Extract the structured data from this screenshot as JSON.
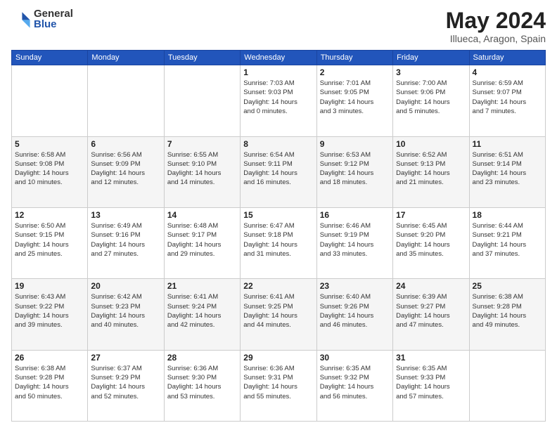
{
  "header": {
    "logo_general": "General",
    "logo_blue": "Blue",
    "month": "May 2024",
    "location": "Illueca, Aragon, Spain"
  },
  "weekdays": [
    "Sunday",
    "Monday",
    "Tuesday",
    "Wednesday",
    "Thursday",
    "Friday",
    "Saturday"
  ],
  "weeks": [
    [
      {
        "day": "",
        "info": ""
      },
      {
        "day": "",
        "info": ""
      },
      {
        "day": "",
        "info": ""
      },
      {
        "day": "1",
        "info": "Sunrise: 7:03 AM\nSunset: 9:03 PM\nDaylight: 14 hours\nand 0 minutes."
      },
      {
        "day": "2",
        "info": "Sunrise: 7:01 AM\nSunset: 9:05 PM\nDaylight: 14 hours\nand 3 minutes."
      },
      {
        "day": "3",
        "info": "Sunrise: 7:00 AM\nSunset: 9:06 PM\nDaylight: 14 hours\nand 5 minutes."
      },
      {
        "day": "4",
        "info": "Sunrise: 6:59 AM\nSunset: 9:07 PM\nDaylight: 14 hours\nand 7 minutes."
      }
    ],
    [
      {
        "day": "5",
        "info": "Sunrise: 6:58 AM\nSunset: 9:08 PM\nDaylight: 14 hours\nand 10 minutes."
      },
      {
        "day": "6",
        "info": "Sunrise: 6:56 AM\nSunset: 9:09 PM\nDaylight: 14 hours\nand 12 minutes."
      },
      {
        "day": "7",
        "info": "Sunrise: 6:55 AM\nSunset: 9:10 PM\nDaylight: 14 hours\nand 14 minutes."
      },
      {
        "day": "8",
        "info": "Sunrise: 6:54 AM\nSunset: 9:11 PM\nDaylight: 14 hours\nand 16 minutes."
      },
      {
        "day": "9",
        "info": "Sunrise: 6:53 AM\nSunset: 9:12 PM\nDaylight: 14 hours\nand 18 minutes."
      },
      {
        "day": "10",
        "info": "Sunrise: 6:52 AM\nSunset: 9:13 PM\nDaylight: 14 hours\nand 21 minutes."
      },
      {
        "day": "11",
        "info": "Sunrise: 6:51 AM\nSunset: 9:14 PM\nDaylight: 14 hours\nand 23 minutes."
      }
    ],
    [
      {
        "day": "12",
        "info": "Sunrise: 6:50 AM\nSunset: 9:15 PM\nDaylight: 14 hours\nand 25 minutes."
      },
      {
        "day": "13",
        "info": "Sunrise: 6:49 AM\nSunset: 9:16 PM\nDaylight: 14 hours\nand 27 minutes."
      },
      {
        "day": "14",
        "info": "Sunrise: 6:48 AM\nSunset: 9:17 PM\nDaylight: 14 hours\nand 29 minutes."
      },
      {
        "day": "15",
        "info": "Sunrise: 6:47 AM\nSunset: 9:18 PM\nDaylight: 14 hours\nand 31 minutes."
      },
      {
        "day": "16",
        "info": "Sunrise: 6:46 AM\nSunset: 9:19 PM\nDaylight: 14 hours\nand 33 minutes."
      },
      {
        "day": "17",
        "info": "Sunrise: 6:45 AM\nSunset: 9:20 PM\nDaylight: 14 hours\nand 35 minutes."
      },
      {
        "day": "18",
        "info": "Sunrise: 6:44 AM\nSunset: 9:21 PM\nDaylight: 14 hours\nand 37 minutes."
      }
    ],
    [
      {
        "day": "19",
        "info": "Sunrise: 6:43 AM\nSunset: 9:22 PM\nDaylight: 14 hours\nand 39 minutes."
      },
      {
        "day": "20",
        "info": "Sunrise: 6:42 AM\nSunset: 9:23 PM\nDaylight: 14 hours\nand 40 minutes."
      },
      {
        "day": "21",
        "info": "Sunrise: 6:41 AM\nSunset: 9:24 PM\nDaylight: 14 hours\nand 42 minutes."
      },
      {
        "day": "22",
        "info": "Sunrise: 6:41 AM\nSunset: 9:25 PM\nDaylight: 14 hours\nand 44 minutes."
      },
      {
        "day": "23",
        "info": "Sunrise: 6:40 AM\nSunset: 9:26 PM\nDaylight: 14 hours\nand 46 minutes."
      },
      {
        "day": "24",
        "info": "Sunrise: 6:39 AM\nSunset: 9:27 PM\nDaylight: 14 hours\nand 47 minutes."
      },
      {
        "day": "25",
        "info": "Sunrise: 6:38 AM\nSunset: 9:28 PM\nDaylight: 14 hours\nand 49 minutes."
      }
    ],
    [
      {
        "day": "26",
        "info": "Sunrise: 6:38 AM\nSunset: 9:28 PM\nDaylight: 14 hours\nand 50 minutes."
      },
      {
        "day": "27",
        "info": "Sunrise: 6:37 AM\nSunset: 9:29 PM\nDaylight: 14 hours\nand 52 minutes."
      },
      {
        "day": "28",
        "info": "Sunrise: 6:36 AM\nSunset: 9:30 PM\nDaylight: 14 hours\nand 53 minutes."
      },
      {
        "day": "29",
        "info": "Sunrise: 6:36 AM\nSunset: 9:31 PM\nDaylight: 14 hours\nand 55 minutes."
      },
      {
        "day": "30",
        "info": "Sunrise: 6:35 AM\nSunset: 9:32 PM\nDaylight: 14 hours\nand 56 minutes."
      },
      {
        "day": "31",
        "info": "Sunrise: 6:35 AM\nSunset: 9:33 PM\nDaylight: 14 hours\nand 57 minutes."
      },
      {
        "day": "",
        "info": ""
      }
    ]
  ]
}
